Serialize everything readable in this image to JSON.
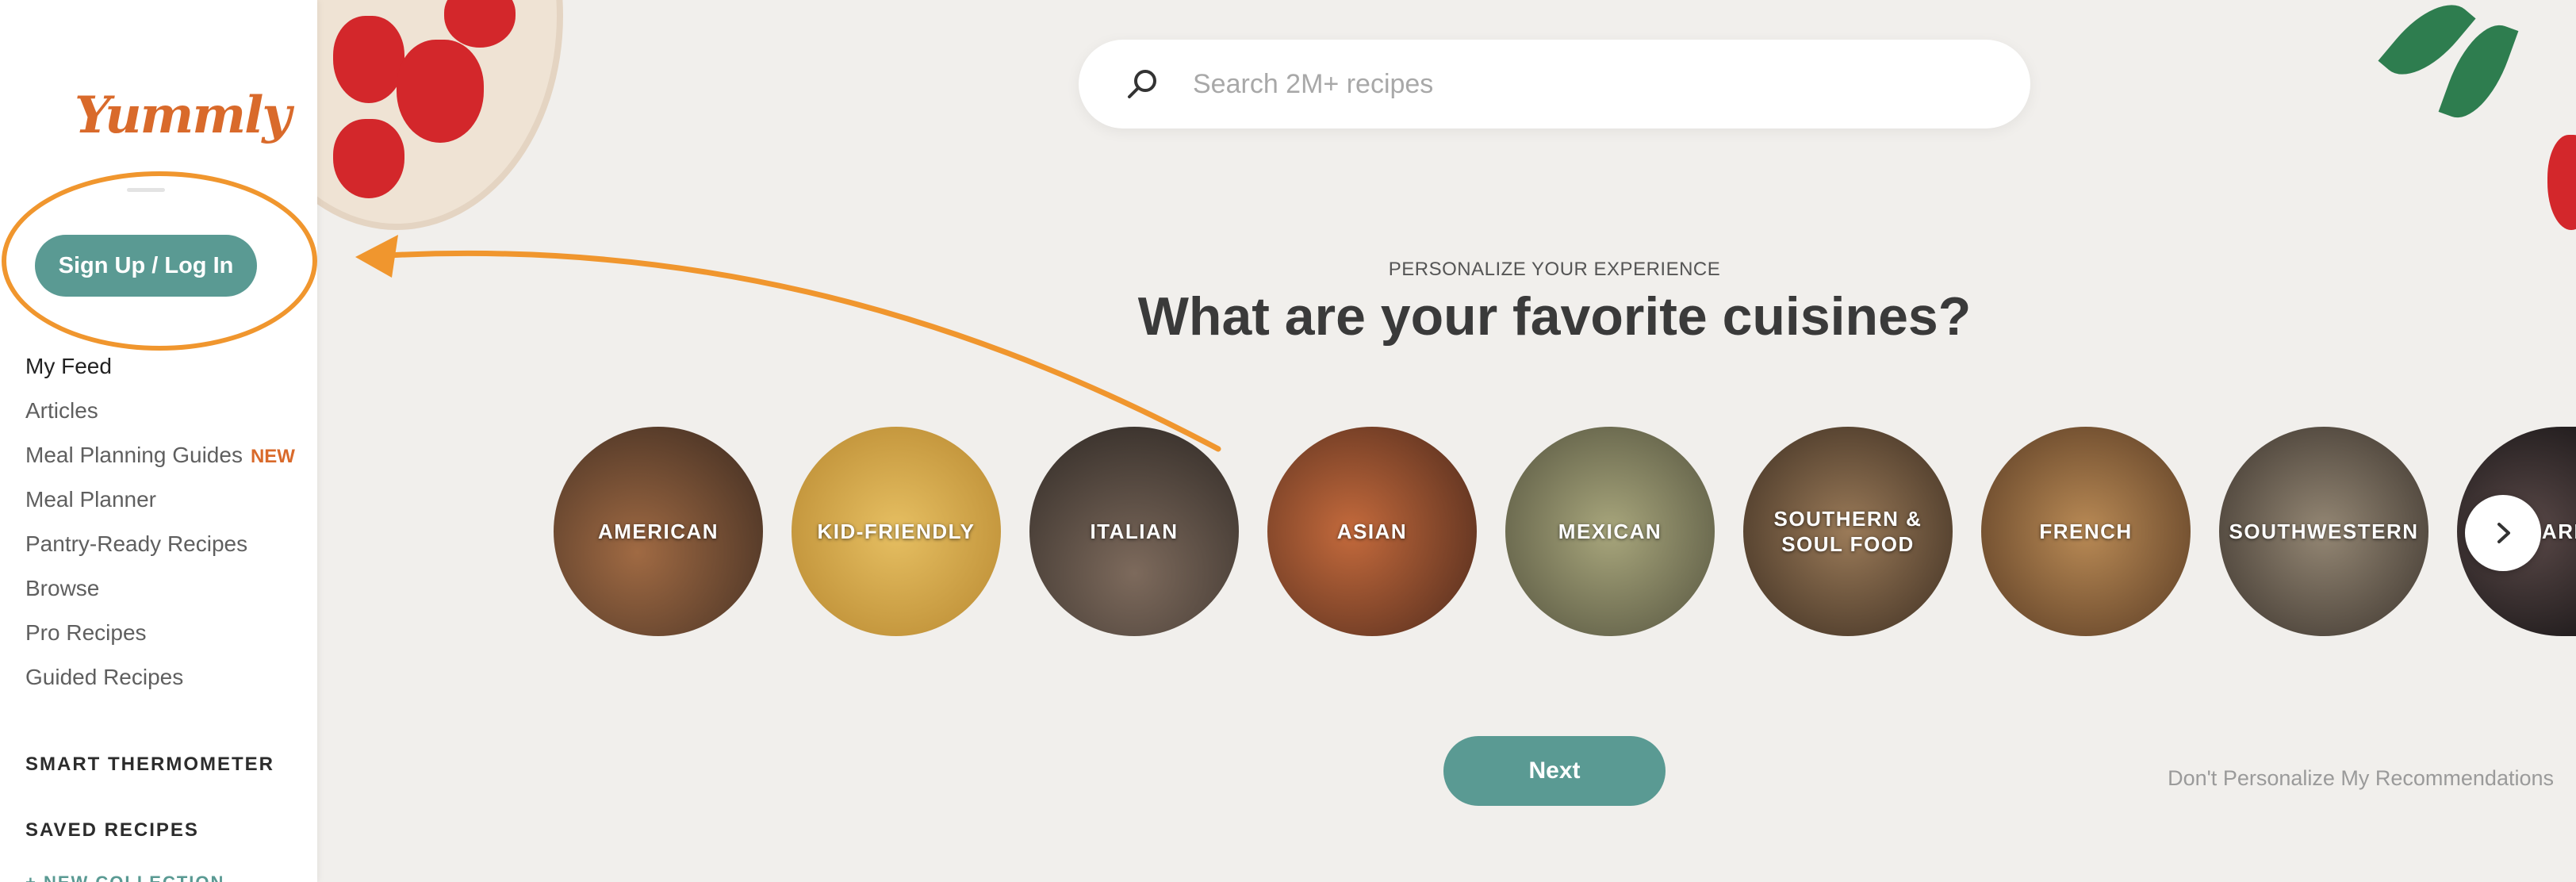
{
  "brand": {
    "logo_text": "Yummly",
    "accent": "#d96a2b",
    "primary": "#5a9a93"
  },
  "sidebar": {
    "signup_label": "Sign Up / Log In",
    "nav": [
      {
        "label": "My Feed",
        "badge": ""
      },
      {
        "label": "Articles",
        "badge": ""
      },
      {
        "label": "Meal Planning Guides",
        "badge": "NEW"
      },
      {
        "label": "Meal Planner",
        "badge": ""
      },
      {
        "label": "Pantry-Ready Recipes",
        "badge": ""
      },
      {
        "label": "Browse",
        "badge": ""
      },
      {
        "label": "Pro Recipes",
        "badge": ""
      },
      {
        "label": "Guided Recipes",
        "badge": ""
      }
    ],
    "smart_thermometer": "SMART THERMOMETER",
    "saved_recipes": "SAVED RECIPES",
    "new_collection": "+ NEW COLLECTION"
  },
  "search": {
    "placeholder": "Search 2M+ recipes",
    "icon": "search-icon"
  },
  "onboarding": {
    "eyebrow": "PERSONALIZE YOUR EXPERIENCE",
    "headline": "What are your favorite cuisines?",
    "cuisines": [
      {
        "label": "AMERICAN",
        "color": "#6e4b35"
      },
      {
        "label": "KID-FRIENDLY",
        "color": "#d2a24a"
      },
      {
        "label": "ITALIAN",
        "color": "#4a413c"
      },
      {
        "label": "ASIAN",
        "color": "#8a4a2e"
      },
      {
        "label": "MEXICAN",
        "color": "#7b7a5c"
      },
      {
        "label": "SOUTHERN & SOUL FOOD",
        "color": "#6b5440"
      },
      {
        "label": "FRENCH",
        "color": "#8e6540"
      },
      {
        "label": "SOUTHWESTERN",
        "color": "#6d6255"
      },
      {
        "label": "BARBECUE",
        "color": "#4b3c3a"
      }
    ],
    "next_label": "Next",
    "skip_label": "Don't Personalize My Recommendations"
  }
}
